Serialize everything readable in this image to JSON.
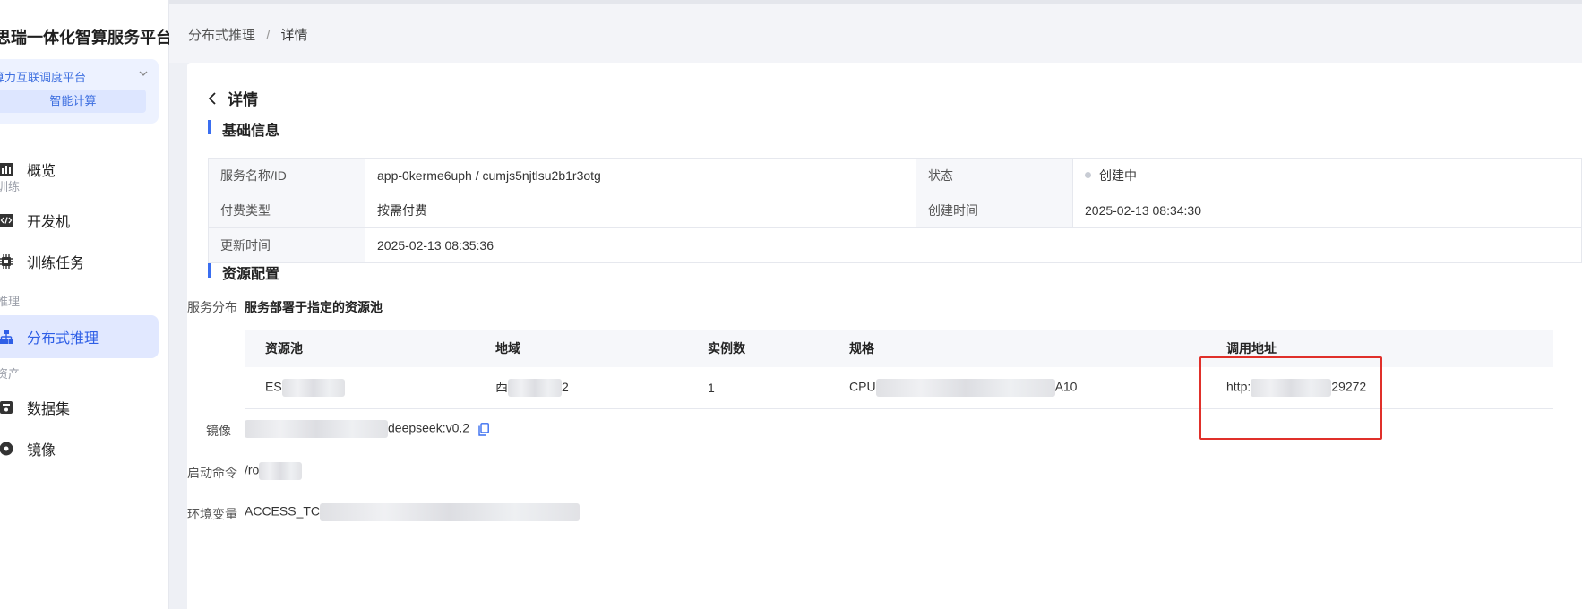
{
  "sidebar": {
    "brand": "思瑞一体化智算服务平台",
    "platform_select": "算力互联调度平台",
    "platform_sub": "智能计算",
    "items": [
      {
        "label": "概览"
      },
      {
        "section": "训练"
      },
      {
        "label": "开发机"
      },
      {
        "label": "训练任务"
      },
      {
        "section": "推理"
      },
      {
        "label": "分布式推理"
      },
      {
        "section": "资产"
      },
      {
        "label": "数据集"
      },
      {
        "label": "镜像"
      }
    ]
  },
  "breadcrumb": {
    "parent": "分布式推理",
    "separator": "/",
    "current": "详情"
  },
  "page": {
    "back_title": "详情"
  },
  "basic_info": {
    "title": "基础信息",
    "rows": [
      {
        "k1": "服务名称/ID",
        "v1": "app-0kerme6uph / cumjs5njtlsu2b1r3otg",
        "k2": "状态",
        "v2": "创建中"
      },
      {
        "k1": "付费类型",
        "v1": "按需付费",
        "k2": "创建时间",
        "v2": "2025-02-13 08:34:30"
      },
      {
        "k1": "更新时间",
        "v1": "2025-02-13 08:35:36"
      }
    ]
  },
  "resource": {
    "title": "资源配置",
    "service_dist_label": "服务分布",
    "service_dist_value": "服务部署于指定的资源池",
    "table": {
      "headers": [
        "资源池",
        "地域",
        "实例数",
        "规格",
        "调用地址"
      ],
      "row": {
        "pool_prefix": "ES",
        "region_prefix": "西",
        "region_suffix": "2",
        "instances": "1",
        "spec_prefix": "CPU",
        "spec_suffix": "A10",
        "url_prefix": "http:",
        "url_suffix": "29272"
      }
    },
    "image_label": "镜像",
    "image_suffix": "deepseek:v0.2",
    "cmd_label": "启动命令",
    "cmd_prefix": "/ro",
    "env_label": "环境变量",
    "env_prefix": "ACCESS_TC"
  },
  "colors": {
    "accent": "#3a6ef0",
    "highlight": "#e0302a",
    "active_bg": "#e1e8ff"
  }
}
